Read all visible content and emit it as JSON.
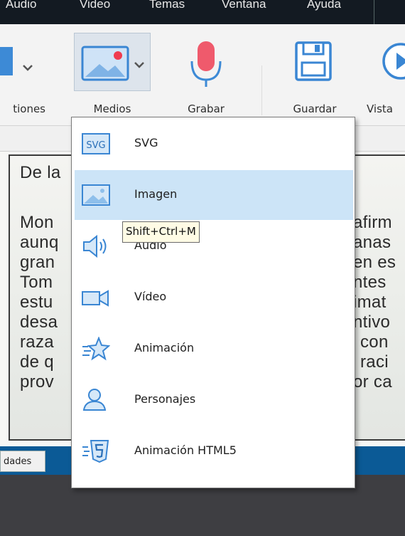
{
  "menubar": {
    "items": [
      "Audio",
      "Video",
      "Temas",
      "Ventana",
      "Ayuda"
    ]
  },
  "ribbon": {
    "buttons": [
      {
        "label": "tiones"
      },
      {
        "label": "Medios"
      },
      {
        "label": "Grabar"
      },
      {
        "label": "Guardar"
      },
      {
        "label": "Vista"
      }
    ]
  },
  "slide": {
    "lines": [
      {
        "left": "De la",
        "right": ""
      },
      {
        "left": "Mon",
        "right": "afirm"
      },
      {
        "left": "aunq",
        "right": "anas"
      },
      {
        "left": "gran",
        "right": "en es"
      },
      {
        "left": "Tom",
        "right": "ntes"
      },
      {
        "left": "estu",
        "right": "imat"
      },
      {
        "left": "desa",
        "right": "ntivo"
      },
      {
        "left": "raza",
        "right": "con"
      },
      {
        "left": "de q",
        "right": "raci"
      },
      {
        "left": "prov",
        "right": "or ca"
      }
    ]
  },
  "statusbar": {
    "tab_label": "dades"
  },
  "media_menu": {
    "items": [
      {
        "label": "SVG",
        "icon": "svg-icon"
      },
      {
        "label": "Imagen",
        "icon": "image-icon"
      },
      {
        "label": "Audio",
        "icon": "audio-speaker-icon"
      },
      {
        "label": "Vídeo",
        "icon": "video-camera-icon"
      },
      {
        "label": "Animación",
        "icon": "animation-star-icon"
      },
      {
        "label": "Personajes",
        "icon": "person-icon"
      },
      {
        "label": "Animación HTML5",
        "icon": "html5-icon"
      }
    ],
    "highlighted_index": 1,
    "tooltip": "Shift+Ctrl+M"
  },
  "colors": {
    "accent_blue": "#2f7fd0",
    "highlight": "#cce4f7",
    "record_red": "#ef5a6c"
  }
}
